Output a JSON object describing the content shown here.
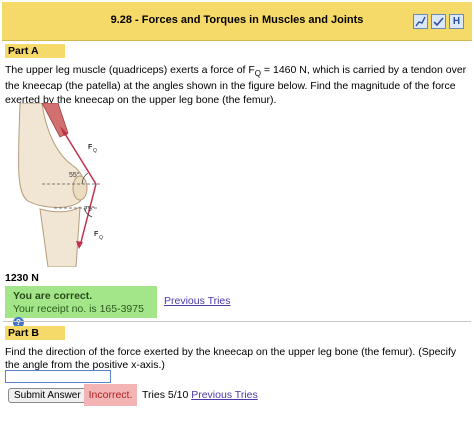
{
  "header": {
    "title": "9.28 - Forces and Torques in Muscles and Joints",
    "icons": [
      "graph-icon",
      "check-icon",
      "help-h-icon"
    ],
    "help_letter": "H"
  },
  "part_a": {
    "label": "Part A",
    "question_pre": "The upper leg muscle (quadriceps) exerts a force of F",
    "question_sub": "Q",
    "question_post": " = 1460 N, which is carried by a tendon over the kneecap (the patella) at the angles shown in the figure below. Find the magnitude of the force exerted by the kneecap on the upper leg bone (the femur).",
    "figure": {
      "upper_angle": "55°",
      "lower_angle": "75°",
      "force_label_upper": "F",
      "force_label_upper_sub": "Q",
      "force_label_lower": "F",
      "force_label_lower_sub": "Q"
    },
    "answer": "1230 N",
    "feedback_title": "You are correct.",
    "receipt": "Your receipt no. is 165-3975",
    "help_symbol": "?",
    "previous_tries": "Previous Tries"
  },
  "part_b": {
    "label": "Part B",
    "question": "Find the direction of the force exerted by the kneecap on the upper leg bone (the femur). (Specify the angle from the positive x-axis.)",
    "input_value": "",
    "submit_label": "Submit Answer",
    "status": "Incorrect.",
    "tries": "Tries 5/10",
    "previous_tries": "Previous Tries"
  }
}
